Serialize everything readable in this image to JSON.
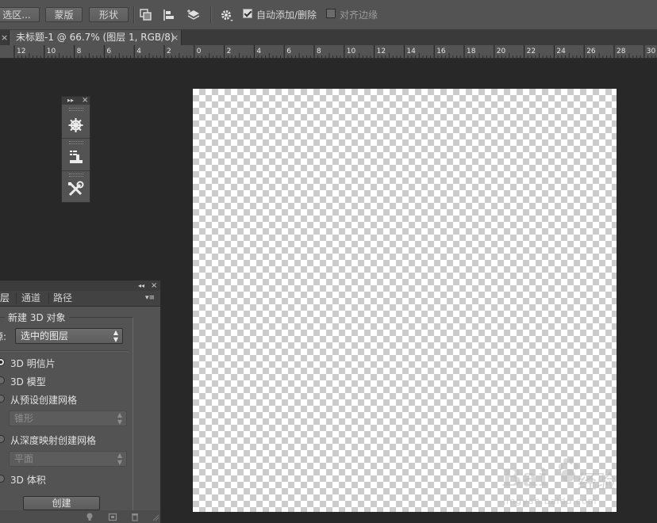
{
  "options_bar": {
    "selection_btn": "选区...",
    "mask_btn": "蒙版",
    "shape_btn": "形状",
    "auto_add_delete": {
      "label": "自动添加/删除",
      "checked": true
    },
    "align_edges": {
      "label": "对齐边缘",
      "checked": false
    },
    "icons": [
      "path-operations-icon",
      "path-alignment-icon",
      "path-arrangement-icon",
      "gear-icon"
    ]
  },
  "document_tab": {
    "title": "未标题-1 @ 66.7% (图层 1, RGB/8)",
    "close": "×",
    "left_close": "×"
  },
  "ruler": {
    "labels": [
      "12",
      "10",
      "8",
      "6",
      "4",
      "2",
      "0",
      "2",
      "4",
      "6",
      "8",
      "10",
      "12",
      "14",
      "16",
      "18",
      "20",
      "22",
      "24",
      "26",
      "28",
      "30"
    ]
  },
  "tool_strip": {
    "collapse_glyph": "▸▸",
    "close_glyph": "×",
    "buttons": [
      "3d-ship-wheel-icon",
      "properties-icon",
      "tools-icon"
    ]
  },
  "panel_3d": {
    "collapse_glyph": "◂◂",
    "close_glyph": "×",
    "tabs": [
      "层",
      "通道",
      "路径"
    ],
    "menu_glyph": "▾≡",
    "group_title": "新建 3D 对象",
    "source_label": "源:",
    "source_value": "选中的图层",
    "options": [
      {
        "label": "3D 明信片",
        "selected": true
      },
      {
        "label": "3D 模型",
        "selected": false
      },
      {
        "label": "从预设创建网格",
        "selected": false
      },
      {
        "label": "从深度映射创建网格",
        "selected": false
      },
      {
        "label": "3D 体积",
        "selected": false
      }
    ],
    "preset_mesh_value": "锥形",
    "depth_map_value": "平面",
    "create_button": "创建"
  },
  "watermark": {
    "brand": "Bai",
    "brand_cn": "经验",
    "site": "jingyan.baidu.com"
  },
  "colors": {
    "workspace_bg": "#282828",
    "panel_bg": "#535353",
    "dark_bar": "#3c3c3c"
  }
}
